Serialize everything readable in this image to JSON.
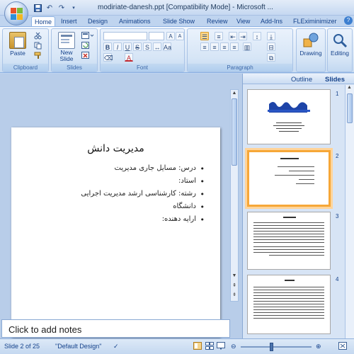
{
  "window": {
    "title": "modiriate-danesh.ppt [Compatibility Mode] - Microsoft ..."
  },
  "ribbon": {
    "tabs": [
      "Home",
      "Insert",
      "Design",
      "Animations",
      "Slide Show",
      "Review",
      "View",
      "Add-Ins",
      "FLEximinimizer"
    ],
    "active_tab": "Home",
    "groups": {
      "clipboard": {
        "label": "Clipboard",
        "paste": "Paste"
      },
      "slides": {
        "label": "Slides",
        "new_slide_line1": "New",
        "new_slide_line2": "Slide"
      },
      "font": {
        "label": "Font"
      },
      "paragraph": {
        "label": "Paragraph"
      },
      "drawing": {
        "label": "Drawing"
      },
      "editing": {
        "label": "Editing"
      }
    }
  },
  "slide_pane": {
    "tabs": [
      "Outline",
      "Slides"
    ],
    "active_tab": "Slides",
    "thumbnails": [
      {
        "number": "1"
      },
      {
        "number": "2"
      },
      {
        "number": "3"
      },
      {
        "number": "4"
      }
    ],
    "selected_number": "2"
  },
  "slide": {
    "title": "مدیریت دانش",
    "bullets": [
      "درس: مسایل جاری مدیریت",
      "استاد:",
      "رشته: کارشناسی ارشد مدیریت اجرایی",
      "دانشگاه",
      "ارایه دهنده:"
    ]
  },
  "notes": {
    "placeholder": "Click to add notes"
  },
  "status": {
    "slide_info": "Slide 2 of 25",
    "theme": "\"Default Design\""
  },
  "colors": {
    "selection": "#f6a738",
    "ribbon_text": "#15428b"
  }
}
